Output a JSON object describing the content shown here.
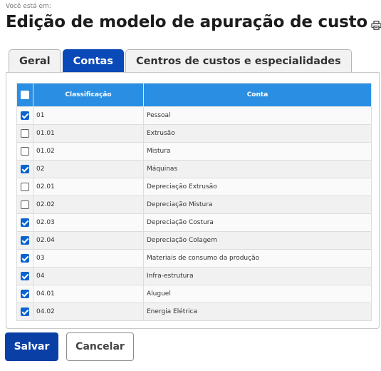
{
  "breadcrumb": "Você está em:",
  "page": {
    "title": "Edição de modelo de apuração de custo",
    "print_icon": "printer-icon"
  },
  "tabs": [
    {
      "label": "Geral",
      "active": false
    },
    {
      "label": "Contas",
      "active": true
    },
    {
      "label": "Centros de custos e especialidades",
      "active": false
    }
  ],
  "table": {
    "select_all_checked": false,
    "columns": [
      "Classificação",
      "Conta"
    ],
    "rows": [
      {
        "checked": true,
        "code": "01",
        "account": "Pessoal"
      },
      {
        "checked": false,
        "code": "01.01",
        "account": "Extrusão"
      },
      {
        "checked": false,
        "code": "01.02",
        "account": "Mistura"
      },
      {
        "checked": true,
        "code": "02",
        "account": "Máquinas"
      },
      {
        "checked": false,
        "code": "02.01",
        "account": "Depreciação Extrusão"
      },
      {
        "checked": false,
        "code": "02.02",
        "account": "Depreciação Mistura"
      },
      {
        "checked": true,
        "code": "02.03",
        "account": "Depreciação Costura"
      },
      {
        "checked": true,
        "code": "02.04",
        "account": "Depreciação Colagem"
      },
      {
        "checked": true,
        "code": "03",
        "account": "Materiais de consumo da produção"
      },
      {
        "checked": true,
        "code": "04",
        "account": "Infra-estrutura"
      },
      {
        "checked": true,
        "code": "04.01",
        "account": "Aluguel"
      },
      {
        "checked": true,
        "code": "04.02",
        "account": "Energia Elétrica"
      }
    ]
  },
  "actions": {
    "save_label": "Salvar",
    "cancel_label": "Cancelar"
  },
  "colors": {
    "primary": "#0a49b8",
    "header": "#2a8fe3",
    "checkbox": "#0b63ce"
  }
}
